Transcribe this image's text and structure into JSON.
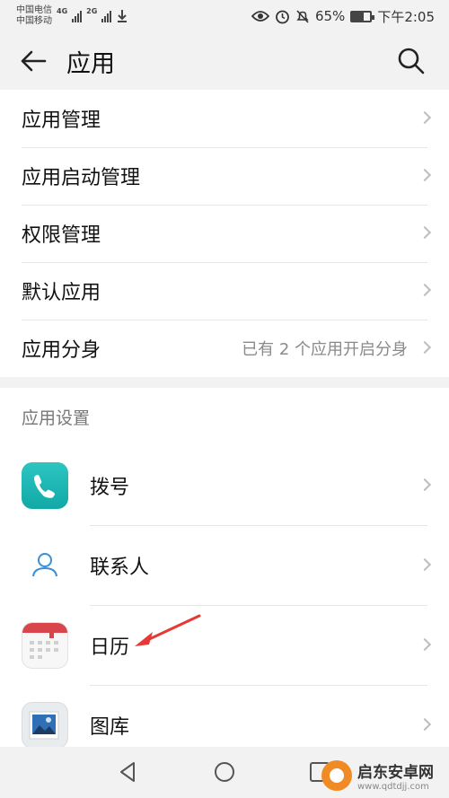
{
  "status_bar": {
    "carrier1": "中国电信",
    "carrier2": "中国移动",
    "net1": "4G",
    "net2": "2G",
    "battery_text": "65%",
    "battery_level": 0.65,
    "time": "下午2:05",
    "icons": [
      "eye-icon",
      "alarm-icon",
      "mute-icon",
      "battery-icon",
      "download-icon"
    ]
  },
  "header": {
    "back_icon": "back-arrow-icon",
    "title": "应用",
    "search_icon": "search-icon"
  },
  "settings_list": [
    {
      "label": "应用管理",
      "value": ""
    },
    {
      "label": "应用启动管理",
      "value": ""
    },
    {
      "label": "权限管理",
      "value": ""
    },
    {
      "label": "默认应用",
      "value": ""
    },
    {
      "label": "应用分身",
      "value": "已有 2 个应用开启分身"
    }
  ],
  "app_settings": {
    "section_title": "应用设置",
    "apps": [
      {
        "label": "拨号",
        "icon": "phone-icon"
      },
      {
        "label": "联系人",
        "icon": "contacts-icon"
      },
      {
        "label": "日历",
        "icon": "calendar-icon"
      },
      {
        "label": "图库",
        "icon": "gallery-icon"
      }
    ]
  },
  "watermark": {
    "title": "启东安卓网",
    "url": "www.qdtdjj.com"
  },
  "colors": {
    "background": "#f2f2f2",
    "card": "#ffffff",
    "phone_icon": "#19b3b0",
    "annotation_arrow": "#e53935"
  }
}
